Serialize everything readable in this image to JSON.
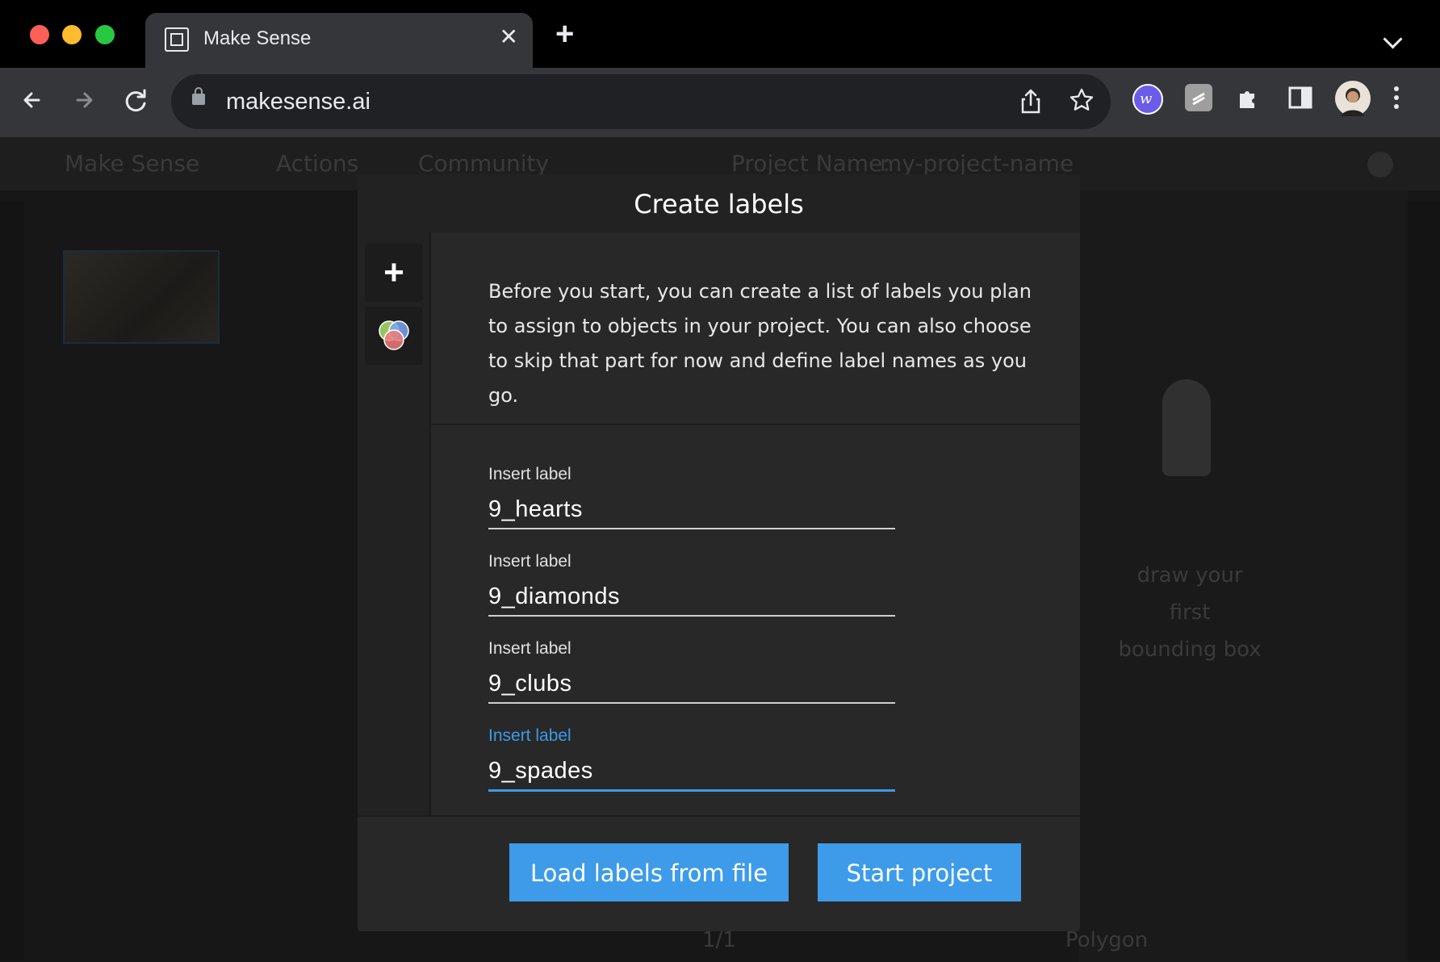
{
  "browser": {
    "tab_title": "Make Sense",
    "tab_close": "✕",
    "new_tab": "+",
    "url": "makesense.ai"
  },
  "app_background": {
    "brand": "Make Sense",
    "menu_actions": "Actions",
    "menu_community": "Community",
    "project_name_label": "Project Name:",
    "project_name_value": "my-project-name",
    "right_hint": "draw your first bounding box",
    "pager": "1/1",
    "polygon": "Polygon"
  },
  "modal": {
    "title": "Create labels",
    "description": "Before you start, you can create a list of labels you plan to assign to objects in your project. You can also choose to skip that part for now and define label names as you go.",
    "labels": [
      {
        "caption": "Insert label",
        "value": "9_hearts",
        "color": "#4d98a8",
        "focused": false
      },
      {
        "caption": "Insert label",
        "value": "9_diamonds",
        "color": "#f27633",
        "focused": false
      },
      {
        "caption": "Insert label",
        "value": "9_clubs",
        "color": "#9bcb3c",
        "focused": false
      },
      {
        "caption": "Insert label",
        "value": "9_spades",
        "color": "#5ecf85",
        "focused": true
      }
    ],
    "load_button": "Load labels from file",
    "start_button": "Start project"
  },
  "colors": {
    "accent": "#3d9be9",
    "modal_bg": "#282828"
  }
}
